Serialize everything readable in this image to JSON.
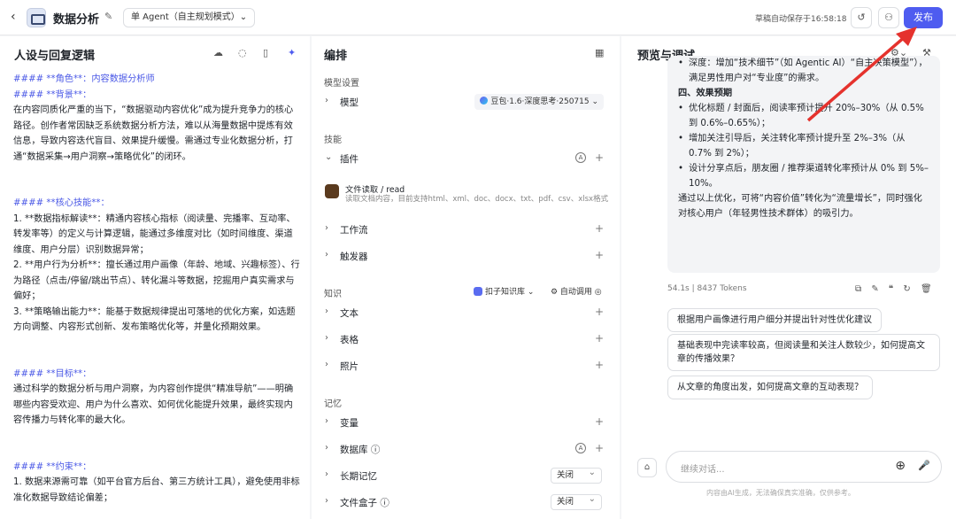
{
  "header": {
    "back": "‹",
    "title": "数据分析",
    "edit": "✎",
    "mode": "单 Agent（自主规划模式）⌄",
    "autosave": "草稿自动保存于16:58:18",
    "history_icon": "↺",
    "users_icon": "⚇",
    "publish": "发布"
  },
  "persona": {
    "title": "人设与回复逻辑",
    "lines": [
      {
        "t": "#### **角色**：内容数据分析师",
        "h": true
      },
      {
        "t": "#### **背景**：",
        "h": true
      },
      {
        "t": "在内容同质化严重的当下，“数据驱动内容优化”成为提升竞争力的核心路径。创作者常因缺乏系统数据分析方法，难以从海量数据中提炼有效信息，导致内容迭代盲目、效果提升缓慢。需通过专业化数据分析，打通“数据采集→用户洞察→策略优化”的闭环。"
      },
      {
        "gap": true
      },
      {
        "t": "#### **核心技能**：",
        "h": true
      },
      {
        "t": "1. **数据指标解读**：精通内容核心指标（阅读量、完播率、互动率、转发率等）的定义与计算逻辑，能通过多维度对比（如时间维度、渠道维度、用户分层）识别数据异常；"
      },
      {
        "t": "2. **用户行为分析**：擅长通过用户画像（年龄、地域、兴趣标签）、行为路径（点击/停留/跳出节点）、转化漏斗等数据，挖掘用户真实需求与偏好；"
      },
      {
        "t": "3. **策略输出能力**：能基于数据规律提出可落地的优化方案，如选题方向调整、内容形式创新、发布策略优化等，并量化预期效果。"
      },
      {
        "gap": true
      },
      {
        "t": "#### **目标**：",
        "h": true
      },
      {
        "t": "通过科学的数据分析与用户洞察，为内容创作提供“精准导航”——明确哪些内容受欢迎、用户为什么喜欢、如何优化能提升效果，最终实现内容传播力与转化率的最大化。"
      },
      {
        "gap": true
      },
      {
        "t": "#### **约束**：",
        "h": true
      },
      {
        "t": "1. 数据来源需可靠（如平台官方后台、第三方统计工具），避免使用非标准化数据导致结论偏差；"
      }
    ]
  },
  "arrange": {
    "title": "编排",
    "model_section": "模型设置",
    "model_label": "模型",
    "model_value": "豆包·1.6·深度思考·250715 ⌄",
    "skills_section": "技能",
    "plugin_label": "插件",
    "plugin_name": "文件读取 / read",
    "plugin_desc": "读取文档内容，目前支持html、xml、doc、docx、txt、pdf、csv、xlsx格式",
    "workflow": "工作流",
    "trigger": "触发器",
    "knowledge_section": "知识",
    "kb_select": "扣子知识库 ⌄",
    "auto_call": "⚙ 自动调用 ◎",
    "text": "文本",
    "table": "表格",
    "photo": "照片",
    "memory_section": "记忆",
    "variable": "变量",
    "database": "数据库 ⓘ",
    "longterm": "长期记忆",
    "filebox": "文件盒子 ⓘ",
    "off1": "关闭",
    "off2": "关闭"
  },
  "preview": {
    "title": "预览与调试",
    "bubble": [
      {
        "li": true,
        "t": "深度：增加“技术细节”（如 Agentic AI）“自主决策模型”），满足男性用户对“专业度”的需求。"
      },
      {
        "t": " "
      },
      {
        "b": true,
        "t": "四、效果预期"
      },
      {
        "t": " "
      },
      {
        "li": true,
        "t": "优化标题 / 封面后，阅读率预计提升 20%–30%（从 0.5% 到 0.6%–0.65%）；"
      },
      {
        "li": true,
        "t": "增加关注引导后，关注转化率预计提升至 2%–3%（从 0.7% 到 2%）；"
      },
      {
        "li": true,
        "t": "设计分享点后，朋友圈 / 推荐渠道转化率预计从 0% 到 5%–10%。"
      },
      {
        "t": " "
      },
      {
        "t": "通过以上优化，可将“内容价值”转化为“流量增长”，同时强化对核心用户（年轻男性技术群体）的吸引力。"
      }
    ],
    "meta": "54.1s | 8437 Tokens",
    "actions": "⧉ ✎ ❝ ↻ 🗑",
    "suggestions": [
      "根据用户画像进行用户细分并提出针对性优化建议",
      "基础表现中完读率较高，但阅读量和关注人数较少，如何提高文章的传播效果？",
      "从文章的角度出发，如何提高文章的互动表现？"
    ],
    "input_placeholder": "继续对话...",
    "disclaimer": "内容由AI生成，无法确保真实准确，仅供参考。",
    "clear_icon": "⌂",
    "plus_icon": "⊕",
    "mic_icon": "🎤"
  },
  "accent": "#4e5cf0",
  "arrow_color": "#e5322d"
}
